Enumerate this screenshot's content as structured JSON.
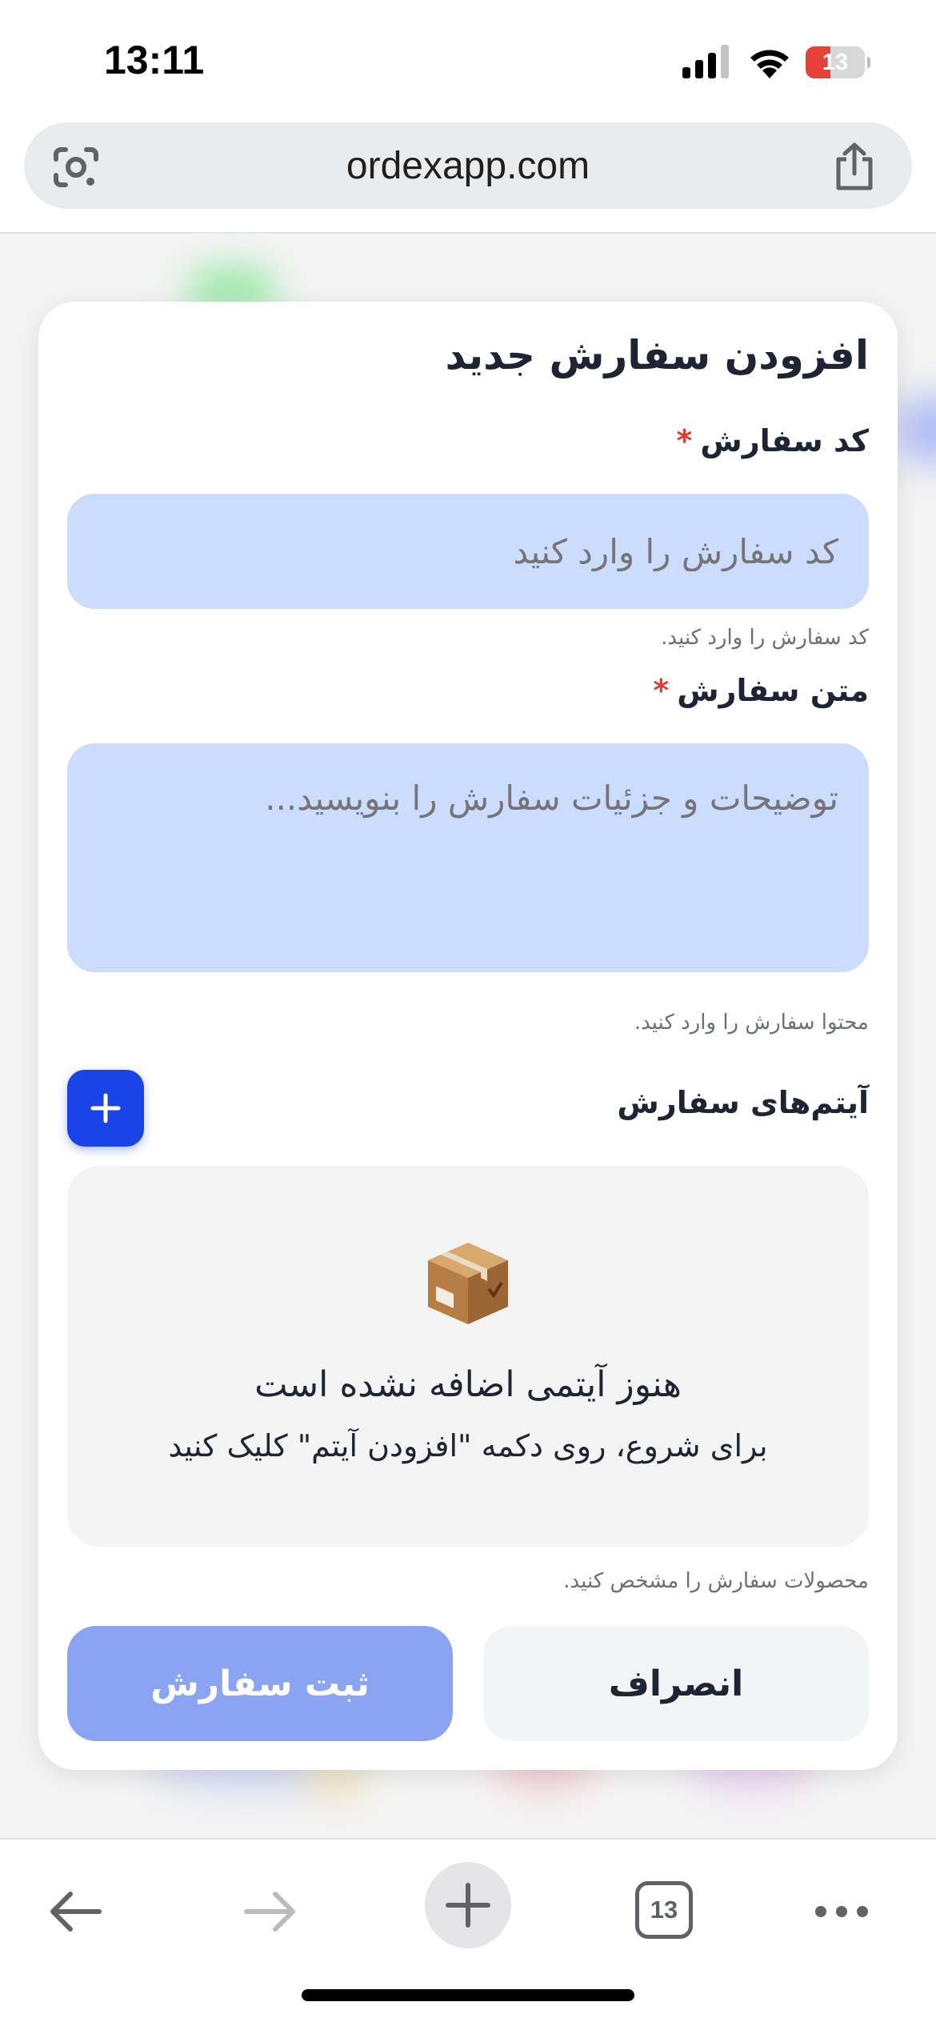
{
  "status_bar": {
    "time": "13:11",
    "battery_level": "13",
    "battery_fraction": 0.13
  },
  "browser": {
    "url": "ordexapp.com",
    "tab_count": "13",
    "icons": [
      "lens-icon",
      "share-icon",
      "back-icon",
      "forward-icon",
      "plus-icon",
      "tabs-icon",
      "more-icon"
    ]
  },
  "modal": {
    "title": "افزودن سفارش جدید",
    "order_code": {
      "label": "کد سفارش",
      "required_mark": "*",
      "placeholder": "کد سفارش را وارد کنید",
      "value": "",
      "hint": "کد سفارش را وارد کنید."
    },
    "order_text": {
      "label": "متن سفارش",
      "required_mark": "*",
      "placeholder": "توضیحات و جزئیات سفارش را بنویسید...",
      "value": "",
      "hint": "محتوا سفارش را وارد کنید."
    },
    "items": {
      "label": "آیتم‌های سفارش",
      "add_icon": "plus-icon",
      "empty_icon": "package-box-icon",
      "empty_title": "هنوز آیتمی اضافه نشده است",
      "empty_subtitle": "برای شروع، روی دکمه \"افزودن آیتم\" کلیک کنید",
      "hint": "محصولات سفارش را مشخص کنید."
    },
    "submit_label": "ثبت سفارش",
    "cancel_label": "انصراف"
  },
  "colors": {
    "primary": "#1a44e8",
    "submit_disabled": "#8aa4f3",
    "input_bg": "#ccdcff",
    "required": "#e53935",
    "battery_low": "#e5403a"
  }
}
